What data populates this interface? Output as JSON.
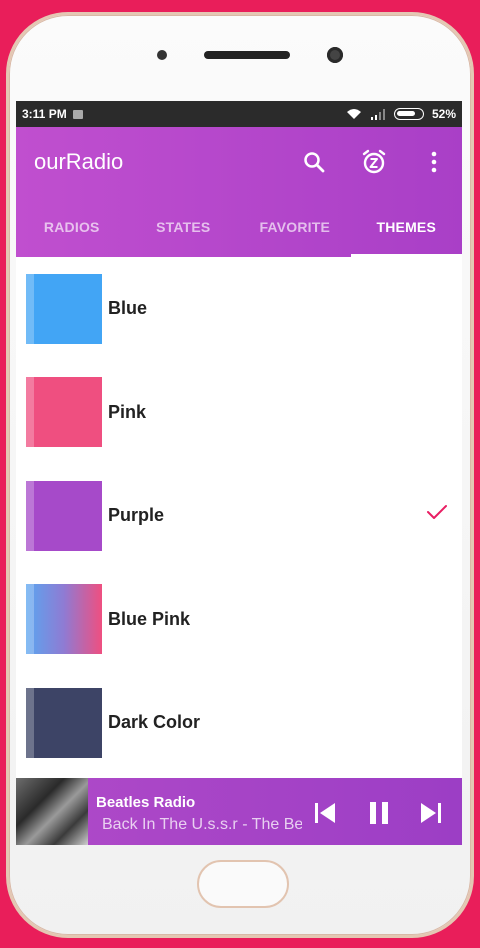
{
  "status": {
    "time": "3:11 PM",
    "battery": "52%"
  },
  "appbar": {
    "title": "ourRadio"
  },
  "tabs": [
    {
      "label": "RADIOS",
      "active": false
    },
    {
      "label": "STATES",
      "active": false
    },
    {
      "label": "FAVORITE",
      "active": false
    },
    {
      "label": "THEMES",
      "active": true
    }
  ],
  "themes": [
    {
      "name": "Blue",
      "selected": false
    },
    {
      "name": "Pink",
      "selected": false
    },
    {
      "name": "Purple",
      "selected": true
    },
    {
      "name": "Blue Pink",
      "selected": false
    },
    {
      "name": "Dark Color",
      "selected": false
    }
  ],
  "player": {
    "title": "Beatles Radio",
    "subtitle": "Back In The U.s.s.r - The Beatles"
  },
  "colors": {
    "accent": "#e91e5a",
    "appbar": "#b545cb",
    "check": "#e91e63"
  }
}
